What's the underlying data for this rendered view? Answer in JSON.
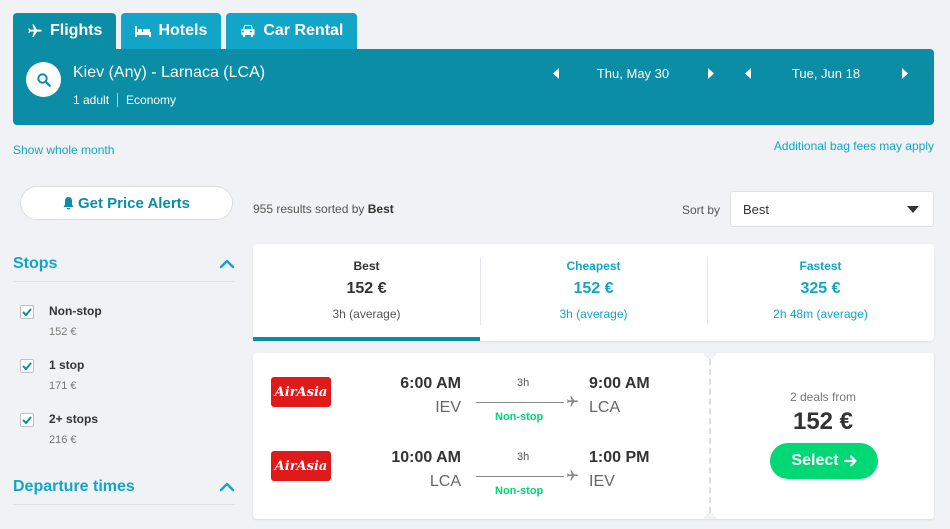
{
  "tabs": [
    {
      "label": "Flights",
      "icon": "plane-icon"
    },
    {
      "label": "Hotels",
      "icon": "bed-icon"
    },
    {
      "label": "Car Rental",
      "icon": "car-icon"
    }
  ],
  "search": {
    "route": "Kiev (Any) - Larnaca (LCA)",
    "passengers": "1 adult",
    "cabin": "Economy",
    "depart_date": "Thu, May 30",
    "return_date": "Tue, Jun 18"
  },
  "links": {
    "whole_month": "Show whole month",
    "bag_fees": "Additional bag fees may apply"
  },
  "sidebar": {
    "alert_label": "Get Price Alerts",
    "stops_title": "Stops",
    "stops": [
      {
        "label": "Non-stop",
        "price": "152 €",
        "checked": true
      },
      {
        "label": "1 stop",
        "price": "171 €",
        "checked": true
      },
      {
        "label": "2+ stops",
        "price": "216 €",
        "checked": true
      }
    ],
    "departure_title": "Departure times"
  },
  "results": {
    "count_text": "955 results sorted by ",
    "sorted_by": "Best",
    "sort_label": "Sort by",
    "sort_value": "Best"
  },
  "sort_tabs": [
    {
      "title": "Best",
      "price": "152 €",
      "duration": "3h (average)",
      "active": true
    },
    {
      "title": "Cheapest",
      "price": "152 €",
      "duration": "3h (average)",
      "active": false
    },
    {
      "title": "Fastest",
      "price": "325 €",
      "duration": "2h 48m (average)",
      "active": false
    }
  ],
  "result": {
    "legs": [
      {
        "airline": "AirAsia",
        "dep_time": "6:00 AM",
        "dep_code": "IEV",
        "duration": "3h",
        "stops": "Non-stop",
        "arr_time": "9:00 AM",
        "arr_code": "LCA"
      },
      {
        "airline": "AirAsia",
        "dep_time": "10:00 AM",
        "dep_code": "LCA",
        "duration": "3h",
        "stops": "Non-stop",
        "arr_time": "1:00 PM",
        "arr_code": "IEV"
      }
    ],
    "deals_text": "2 deals from",
    "price": "152 €",
    "select_label": "Select"
  },
  "colors": {
    "brand": "#0b8da6",
    "accent": "#12a5c8",
    "select": "#00d775",
    "airline": "#e01a1a"
  }
}
